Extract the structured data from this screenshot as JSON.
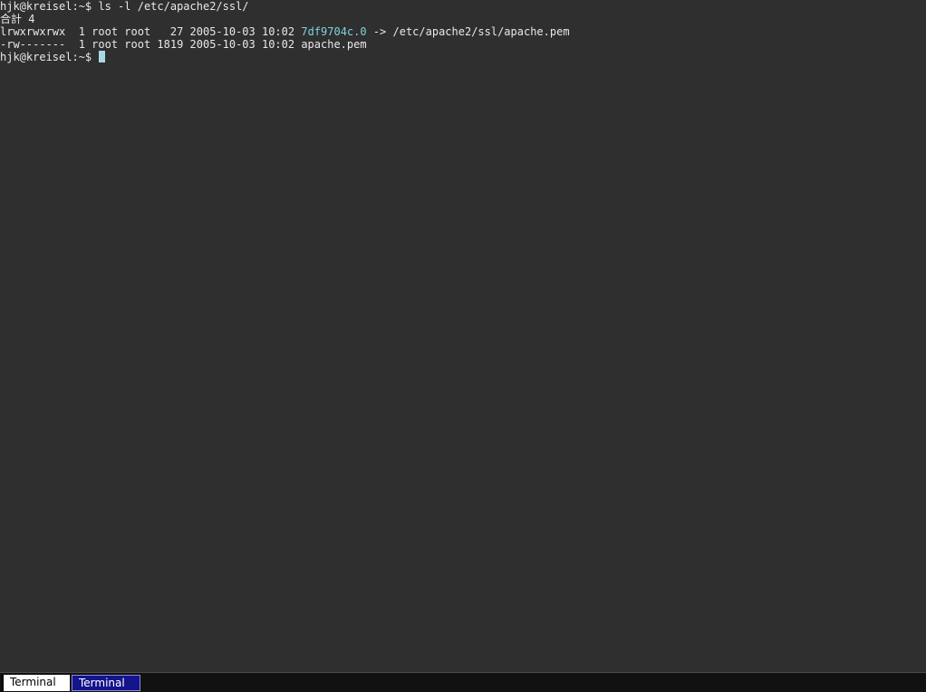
{
  "terminal": {
    "lines": [
      "hjk@kreisel:~$ ls -l /etc/apache2/ssl/",
      "合計 4",
      "lrwxrwxrwx  1 root root   27 2005-10-03 10:02 ",
      "-rw-------  1 root root 1819 2005-10-03 10:02 apache.pem",
      "hjk@kreisel:~$ "
    ],
    "symlink_name": "7df9704c.0",
    "symlink_target": " -> /etc/apache2/ssl/apache.pem"
  },
  "taskbar": {
    "tasks": [
      {
        "label": "Terminal",
        "active": false
      },
      {
        "label": "Terminal",
        "active": true
      }
    ]
  },
  "colors": {
    "background": "#2f2f2f",
    "text": "#e8e8e8",
    "symlink": "#7fd3da",
    "cursor": "#a6dbe6",
    "active_task": "#14148c"
  }
}
